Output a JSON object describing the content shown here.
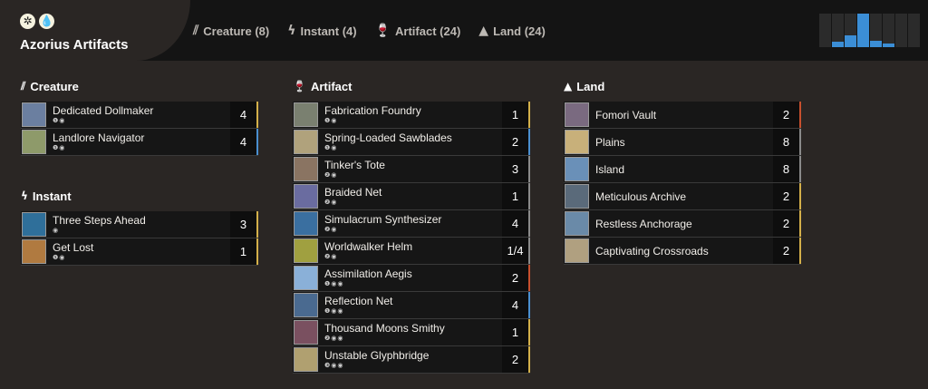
{
  "header": {
    "deck_title": "Azorius Artifacts",
    "mana_icons": [
      {
        "name": "white-mana-icon",
        "glyph": "✲"
      },
      {
        "name": "blue-mana-icon",
        "glyph": "💧"
      }
    ],
    "tabs": [
      {
        "label": "Creature (8)",
        "icon": "claw-icon",
        "glyph": "⫽"
      },
      {
        "label": "Instant (4)",
        "icon": "lightning-icon",
        "glyph": "ϟ"
      },
      {
        "label": "Artifact (24)",
        "icon": "chalice-icon",
        "glyph": "🍷"
      },
      {
        "label": "Land (24)",
        "icon": "mountain-icon",
        "glyph": "▲"
      }
    ],
    "mana_curve": [
      0,
      0.15,
      0.35,
      1.0,
      0.2,
      0.1,
      0,
      0
    ]
  },
  "colors": {
    "white": "#d4b04a",
    "blue": "#4a8fd0",
    "red": "#c8502e",
    "colorless": "#8a8a8a",
    "accent": "#3b8ed6"
  },
  "sections": {
    "creature": {
      "title": "Creature",
      "glyph": "⫽",
      "cards": [
        {
          "name": "Dedicated Dollmaker",
          "cost": "❶◉",
          "qty": "4",
          "bar": "#d4b04a",
          "art": "#6b7fa0"
        },
        {
          "name": "Landlore Navigator",
          "cost": "❶◉",
          "qty": "4",
          "bar": "#4a8fd0",
          "art": "#8e9a6a"
        }
      ]
    },
    "instant": {
      "title": "Instant",
      "glyph": "ϟ",
      "cards": [
        {
          "name": "Three Steps Ahead",
          "cost": "◉",
          "qty": "3",
          "bar": "#d4b04a",
          "art": "#2f6f9a"
        },
        {
          "name": "Get Lost",
          "cost": "❶◉",
          "qty": "1",
          "bar": "#d4b04a",
          "art": "#b07a40"
        }
      ]
    },
    "artifact": {
      "title": "Artifact",
      "glyph": "🍷",
      "cards": [
        {
          "name": "Fabrication Foundry",
          "cost": "❶◉",
          "qty": "1",
          "bar": "#d4b04a",
          "art": "#7a8070"
        },
        {
          "name": "Spring-Loaded Sawblades",
          "cost": "❶◉",
          "qty": "2",
          "bar": "#4a8fd0",
          "art": "#b0a27c"
        },
        {
          "name": "Tinker's Tote",
          "cost": "❷◉",
          "qty": "3",
          "bar": "#8a8a8a",
          "art": "#8a7462"
        },
        {
          "name": "Braided Net",
          "cost": "❷◉",
          "qty": "1",
          "bar": "#8a8a8a",
          "art": "#6a6ca0"
        },
        {
          "name": "Simulacrum Synthesizer",
          "cost": "❷◉",
          "qty": "4",
          "bar": "#8a8a8a",
          "art": "#3a6fa0"
        },
        {
          "name": "Worldwalker Helm",
          "cost": "❷◉",
          "qty": "1/4",
          "bar": "#8a8a8a",
          "art": "#a0a040"
        },
        {
          "name": "Assimilation Aegis",
          "cost": "❶◉◉",
          "qty": "2",
          "bar": "#c8502e",
          "art": "#8ab0d8"
        },
        {
          "name": "Reflection Net",
          "cost": "❶◉◉",
          "qty": "4",
          "bar": "#4a8fd0",
          "art": "#4a6a90"
        },
        {
          "name": "Thousand Moons Smithy",
          "cost": "❷◉◉",
          "qty": "1",
          "bar": "#d4b04a",
          "art": "#7a5060"
        },
        {
          "name": "Unstable Glyphbridge",
          "cost": "❸◉◉",
          "qty": "2",
          "bar": "#d4b04a",
          "art": "#b0a070"
        }
      ]
    },
    "land": {
      "title": "Land",
      "glyph": "▲",
      "cards": [
        {
          "name": "Fomori Vault",
          "cost": "",
          "qty": "2",
          "bar": "#c8502e",
          "art": "#7a6a80"
        },
        {
          "name": "Plains",
          "cost": "",
          "qty": "8",
          "bar": "#8a8a8a",
          "art": "#c8b07a"
        },
        {
          "name": "Island",
          "cost": "",
          "qty": "8",
          "bar": "#8a8a8a",
          "art": "#6a90b8"
        },
        {
          "name": "Meticulous Archive",
          "cost": "",
          "qty": "2",
          "bar": "#d4b04a",
          "art": "#5a6a7a"
        },
        {
          "name": "Restless Anchorage",
          "cost": "",
          "qty": "2",
          "bar": "#d4b04a",
          "art": "#6a8aa8"
        },
        {
          "name": "Captivating Crossroads",
          "cost": "",
          "qty": "2",
          "bar": "#d4b04a",
          "art": "#b0a080"
        }
      ]
    }
  }
}
